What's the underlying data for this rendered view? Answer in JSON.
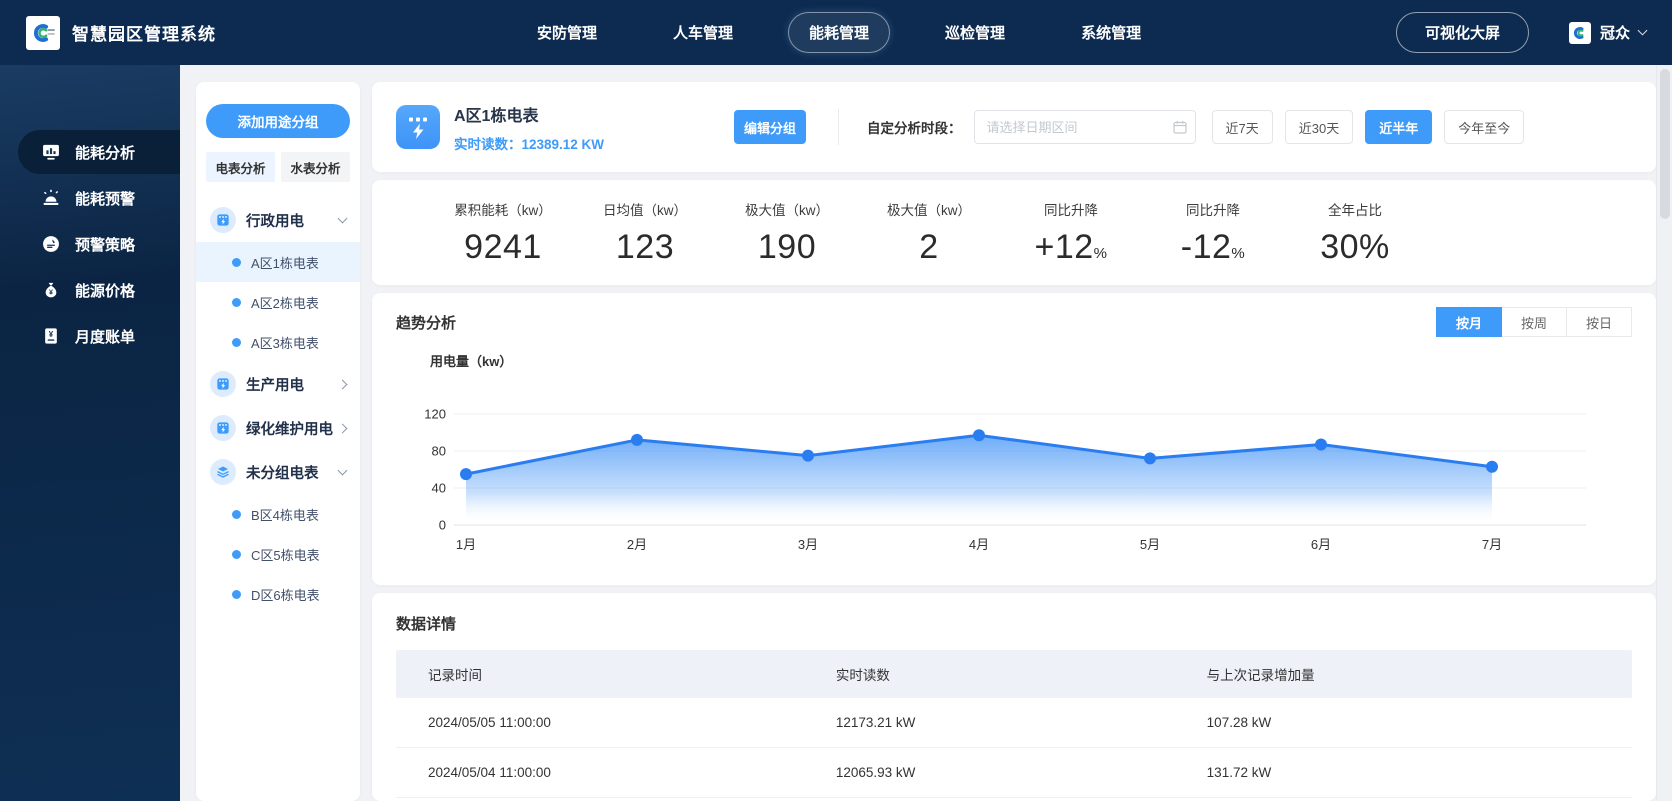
{
  "brand": {
    "title": "智慧园区管理系统"
  },
  "top_nav": {
    "items": [
      {
        "label": "安防管理",
        "active": false
      },
      {
        "label": "人车管理",
        "active": false
      },
      {
        "label": "能耗管理",
        "active": true
      },
      {
        "label": "巡检管理",
        "active": false
      },
      {
        "label": "系统管理",
        "active": false
      }
    ],
    "screen_button": "可视化大屏",
    "user": {
      "name": "冠众"
    }
  },
  "sidebar": {
    "items": [
      {
        "label": "能耗分析",
        "icon": "chart-icon",
        "active": true
      },
      {
        "label": "能耗预警",
        "icon": "alarm-icon",
        "active": false
      },
      {
        "label": "预警策略",
        "icon": "strategy-icon",
        "active": false
      },
      {
        "label": "能源价格",
        "icon": "price-icon",
        "active": false
      },
      {
        "label": "月度账单",
        "icon": "bill-icon",
        "active": false
      }
    ]
  },
  "panel": {
    "add_group_button": "添加用途分组",
    "tabs": [
      {
        "label": "电表分析",
        "active": true
      },
      {
        "label": "水表分析",
        "active": false
      }
    ],
    "selected_meter": "A区1栋电表",
    "tree": [
      {
        "label": "行政用电",
        "icon": "meter-icon",
        "expanded": true,
        "children": [
          "A区1栋电表",
          "A区2栋电表",
          "A区3栋电表"
        ]
      },
      {
        "label": "生产用电",
        "icon": "meter-icon",
        "expanded": false,
        "children": []
      },
      {
        "label": "绿化维护用电",
        "icon": "meter-icon",
        "expanded": false,
        "children": []
      },
      {
        "label": "未分组电表",
        "icon": "layers-icon",
        "expanded": true,
        "children": [
          "B区4栋电表",
          "C区5栋电表",
          "D区6栋电表"
        ]
      }
    ]
  },
  "header": {
    "title": "A区1栋电表",
    "reading_label": "实时读数：",
    "reading_value": "12389.12 KW",
    "edit_button": "编辑分组",
    "period_label": "自定分析时段：",
    "date_placeholder": "请选择日期区间",
    "range_buttons": [
      {
        "label": "近7天",
        "active": false
      },
      {
        "label": "近30天",
        "active": false
      },
      {
        "label": "近半年",
        "active": true
      },
      {
        "label": "今年至今",
        "active": false
      }
    ]
  },
  "stats": [
    {
      "label": "累积能耗（kw）",
      "value": "9241",
      "small_suffix": ""
    },
    {
      "label": "日均值（kw）",
      "value": "123",
      "small_suffix": ""
    },
    {
      "label": "极大值（kw）",
      "value": "190",
      "small_suffix": ""
    },
    {
      "label": "极大值（kw）",
      "value": "2",
      "small_suffix": ""
    },
    {
      "label": "同比升降",
      "value": "+12",
      "small_suffix": "%"
    },
    {
      "label": "同比升降",
      "value": "-12",
      "small_suffix": "%"
    },
    {
      "label": "全年占比",
      "value": "30%",
      "small_suffix": ""
    }
  ],
  "trend": {
    "title": "趋势分析",
    "unit_label": "用电量（kw）",
    "toggles": [
      {
        "label": "按月",
        "active": true
      },
      {
        "label": "按周",
        "active": false
      },
      {
        "label": "按日",
        "active": false
      }
    ]
  },
  "chart_data": {
    "type": "area",
    "title": "趋势分析",
    "ylabel": "用电量（kw）",
    "x": [
      "1月",
      "2月",
      "3月",
      "4月",
      "5月",
      "6月",
      "7月"
    ],
    "series": [
      {
        "name": "用电量",
        "values": [
          55,
          92,
          75,
          97,
          72,
          87,
          63
        ]
      }
    ],
    "ylim": [
      0,
      120
    ],
    "yticks": [
      0,
      40,
      80,
      120
    ],
    "grid": true,
    "legend": false,
    "line_color": "#2a7df0",
    "fill_color": "#4b98f7"
  },
  "table": {
    "title": "数据详情",
    "columns": [
      "记录时间",
      "实时读数",
      "与上次记录增加量"
    ],
    "rows": [
      [
        "2024/05/05 11:00:00",
        "12173.21 kW",
        "107.28 kW"
      ],
      [
        "2024/05/04 11:00:00",
        "12065.93 kW",
        "131.72 kW"
      ]
    ]
  },
  "colors": {
    "accent": "#3e9bfa",
    "nav_bg": "#0d2b50",
    "selected_bg": "#e9f4ff",
    "table_header_bg": "#eef1f8",
    "chart_line": "#2a7df0"
  }
}
